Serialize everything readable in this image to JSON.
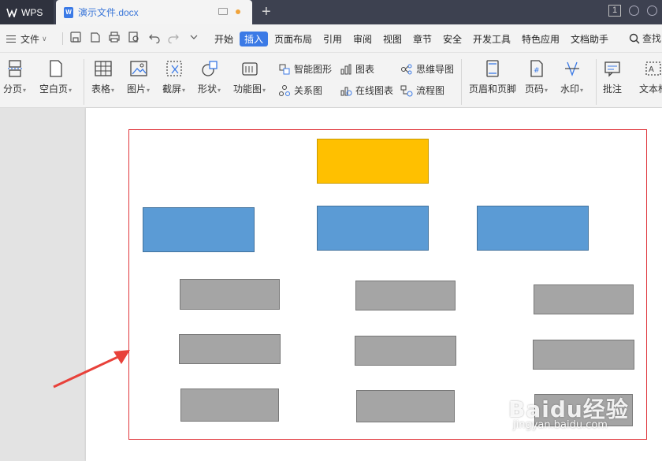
{
  "titlebar": {
    "app_name": "WPS",
    "doc_title": "演示文件.docx",
    "window_count": "1"
  },
  "menubar": {
    "file_label": "文件",
    "tabs": [
      "开始",
      "插入",
      "页面布局",
      "引用",
      "审阅",
      "视图",
      "章节",
      "安全",
      "开发工具",
      "特色应用",
      "文档助手"
    ],
    "active_tab": "插入",
    "search_label": "查找"
  },
  "ribbon": {
    "page_break": "分页",
    "blank_page": "空白页",
    "table": "表格",
    "picture": "图片",
    "screenshot": "截屏",
    "shape": "形状",
    "function_chart": "功能图",
    "smart_shape": "智能图形",
    "chart": "图表",
    "mind_map": "思维导图",
    "relation_chart": "关系图",
    "online_chart": "在线图表",
    "flow_chart": "流程图",
    "header_footer": "页眉和页脚",
    "page_number": "页码",
    "watermark": "水印",
    "comment": "批注",
    "text_box": "文本框"
  },
  "document": {
    "diagram_levels": {
      "level1_count": 1,
      "level2_count": 3,
      "level3_count": 9
    }
  },
  "colors": {
    "accent": "#3b7ae6",
    "top_box": "#ffc000",
    "mid_box": "#5b9bd5",
    "low_box": "#a5a5a5",
    "frame": "#e0363c",
    "arrow": "#e8413a"
  },
  "watermark_overlay": {
    "brand": "Baidu经验",
    "url": "jingyan.baidu.com"
  }
}
